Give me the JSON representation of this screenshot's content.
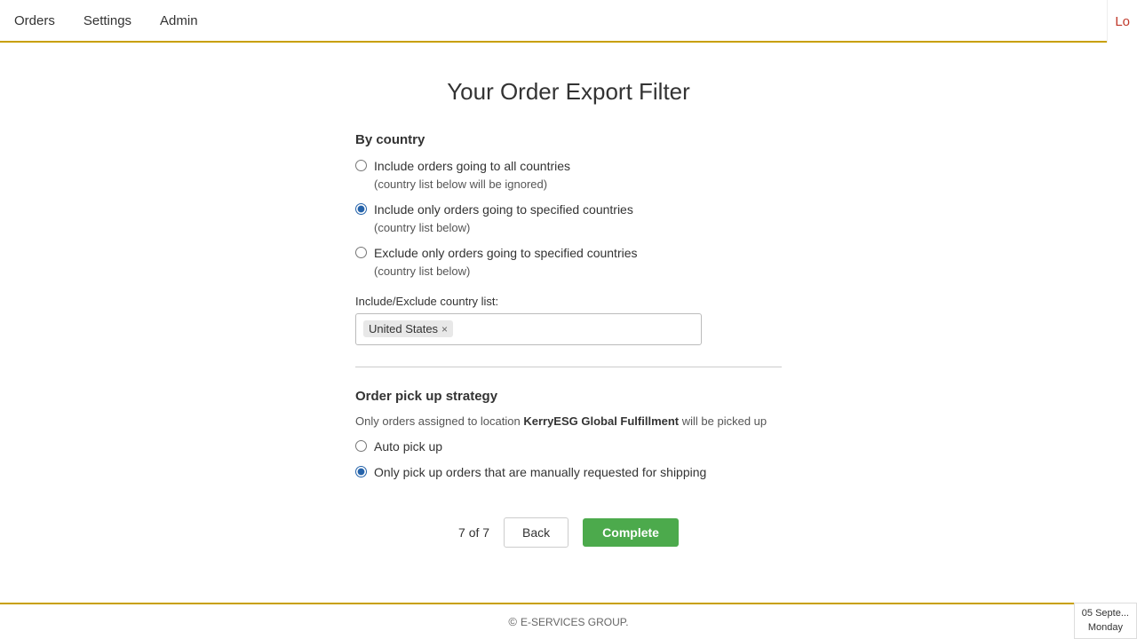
{
  "nav": {
    "items": [
      "Orders",
      "Settings",
      "Admin"
    ],
    "right_label": "Lo"
  },
  "page": {
    "title": "Your Order Export Filter",
    "by_country": {
      "heading": "By country",
      "options": [
        {
          "id": "all_countries",
          "label": "Include orders going to all countries",
          "sub": "(country list below will be ignored)",
          "checked": false
        },
        {
          "id": "specified_include",
          "label": "Include only orders going to specified countries",
          "sub": "(country list below)",
          "checked": true
        },
        {
          "id": "specified_exclude",
          "label": "Exclude only orders going to specified countries",
          "sub": "(country list below)",
          "checked": false
        }
      ],
      "list_label": "Include/Exclude country list:",
      "tags": [
        "United States"
      ]
    },
    "pickup_strategy": {
      "heading": "Order pick up strategy",
      "description_prefix": "Only orders assigned to location ",
      "location_name": "KerryESG Global Fulfillment",
      "description_suffix": " will be picked up",
      "options": [
        {
          "id": "auto_pickup",
          "label": "Auto pick up",
          "checked": false
        },
        {
          "id": "manual_pickup",
          "label": "Only pick up orders that are manually requested for shipping",
          "checked": true
        }
      ]
    },
    "pagination": {
      "current": "7 of 7"
    },
    "buttons": {
      "back": "Back",
      "complete": "Complete"
    }
  },
  "footer": {
    "copyright": "© E-SERVICES GROUP."
  },
  "date_widget": {
    "line1": "05 Septe...",
    "line2": "Monday"
  }
}
